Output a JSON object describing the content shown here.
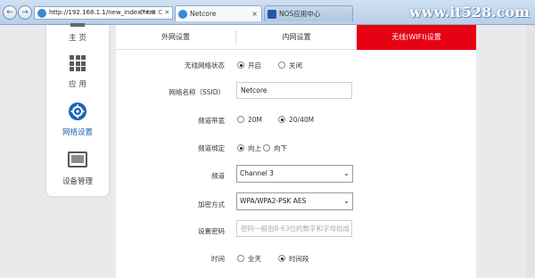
{
  "browser": {
    "url": "http://192.168.1.1/new_index.htm",
    "url_controls": "P ▾ ⊠ C ✕",
    "tabs": [
      {
        "label": "Netcore",
        "active": true
      },
      {
        "label": "NOS应用中心",
        "active": false
      }
    ],
    "watermark": "www.it528.com"
  },
  "sidebar": {
    "items": [
      {
        "label": "主 页"
      },
      {
        "label": "应 用"
      },
      {
        "label": "网络设置"
      },
      {
        "label": "设备管理"
      }
    ]
  },
  "tabs": [
    {
      "label": "外网设置"
    },
    {
      "label": "内网设置"
    },
    {
      "label": "无线(WIFI)设置",
      "active": true
    }
  ],
  "form": {
    "wireless_status": {
      "label": "无线网络状态",
      "options": [
        "开启",
        "关闭"
      ],
      "selected": "开启"
    },
    "ssid": {
      "label": "网络名称（SSID）",
      "value": "Netcore"
    },
    "bandwidth": {
      "label": "频道带宽",
      "options": [
        "20M",
        "20/40M"
      ],
      "selected": "20/40M"
    },
    "binding": {
      "label": "频道绑定",
      "options": [
        "向上",
        "向下"
      ],
      "selected": "向上"
    },
    "channel": {
      "label": "频道",
      "value": "Channel 3"
    },
    "encryption": {
      "label": "加密方式",
      "value": "WPA/WPA2-PSK AES"
    },
    "password": {
      "label": "设置密码",
      "placeholder": "密码一般由8-63位的数字和字母组成"
    },
    "time": {
      "label": "时间",
      "options": [
        "全天",
        "时间段"
      ],
      "selected": "时间段"
    }
  },
  "colors": {
    "accent": "#e60012",
    "active_nav": "#1c63b6"
  }
}
